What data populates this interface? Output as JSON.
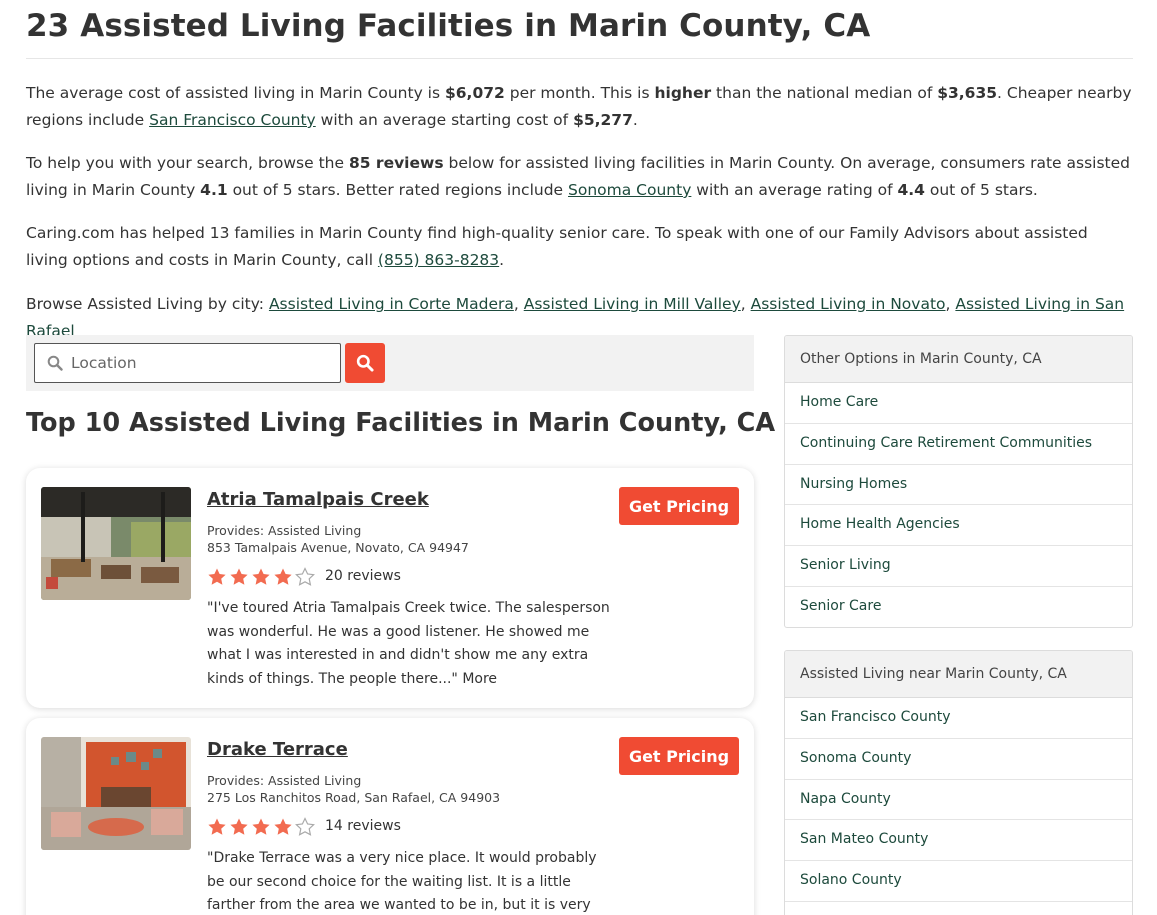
{
  "page": {
    "title": "23 Assisted Living Facilities in Marin County, CA"
  },
  "intro": {
    "p1": {
      "t1": "The average cost of assisted living in Marin County is ",
      "cost": "$6,072",
      "t2": " per month. This is ",
      "higher": "higher",
      "t3": " than the national median of ",
      "median": "$3,635",
      "t4": ". Cheaper nearby regions include ",
      "link": "San Francisco County",
      "t5": " with an average starting cost of ",
      "cost2": "$5,277",
      "t6": "."
    },
    "p2": {
      "t1": "To help you with your search, browse the ",
      "reviews": "85 reviews",
      "t2": " below for assisted living facilities in Marin County. On average, consumers rate assisted living in Marin County ",
      "rating": "4.1",
      "t3": " out of 5 stars. Better rated regions include ",
      "link": "Sonoma County",
      "t4": " with an average rating of ",
      "rating2": "4.4",
      "t5": " out of 5 stars."
    },
    "p3": {
      "t1": "Caring.com has helped 13 families in Marin County find high-quality senior care. To speak with one of our Family Advisors about assisted living options and costs in Marin County, call ",
      "phone": "(855) 863-8283",
      "t2": "."
    },
    "p4": {
      "label": "Browse Assisted Living by city: ",
      "cities": [
        "Assisted Living in Corte Madera",
        "Assisted Living in Mill Valley",
        "Assisted Living in Novato",
        "Assisted Living in San Rafael"
      ],
      "sep": ", "
    }
  },
  "search": {
    "placeholder": "Location"
  },
  "listing": {
    "title": "Top 10 Assisted Living Facilities in Marin County, CA",
    "cards": [
      {
        "name": "Atria Tamalpais Creek",
        "provides": "Provides: Assisted Living",
        "address": "853 Tamalpais Avenue, Novato, CA 94947",
        "rating": 4,
        "reviews": "20 reviews",
        "quote": "\"I've toured Atria Tamalpais Creek twice. The salesperson was wonderful. He was a good listener. He showed me what I was interested in and didn't show me any extra kinds of things. The people there...\" ",
        "more": "More",
        "button": "Get Pricing"
      },
      {
        "name": "Drake Terrace",
        "provides": "Provides: Assisted Living",
        "address": "275 Los Ranchitos Road, San Rafael, CA 94903",
        "rating": 4,
        "reviews": "14 reviews",
        "quote": "\"Drake Terrace was a very nice place. It would probably be our second choice for the waiting list. It is a little farther from the area we wanted to be in, but it is very nice. We like this place....\"",
        "more": "",
        "button": "Get Pricing"
      }
    ]
  },
  "sidebar": {
    "other": {
      "header": "Other Options in Marin County, CA",
      "items": [
        "Home Care",
        "Continuing Care Retirement Communities",
        "Nursing Homes",
        "Home Health Agencies",
        "Senior Living",
        "Senior Care"
      ]
    },
    "near": {
      "header": "Assisted Living near Marin County, CA",
      "items": [
        "San Francisco County",
        "Sonoma County",
        "Napa County",
        "San Mateo County",
        "Solano County",
        ""
      ]
    }
  },
  "colors": {
    "accent": "#f04b33",
    "star": "#f26b50",
    "link": "#1d4a3c"
  }
}
